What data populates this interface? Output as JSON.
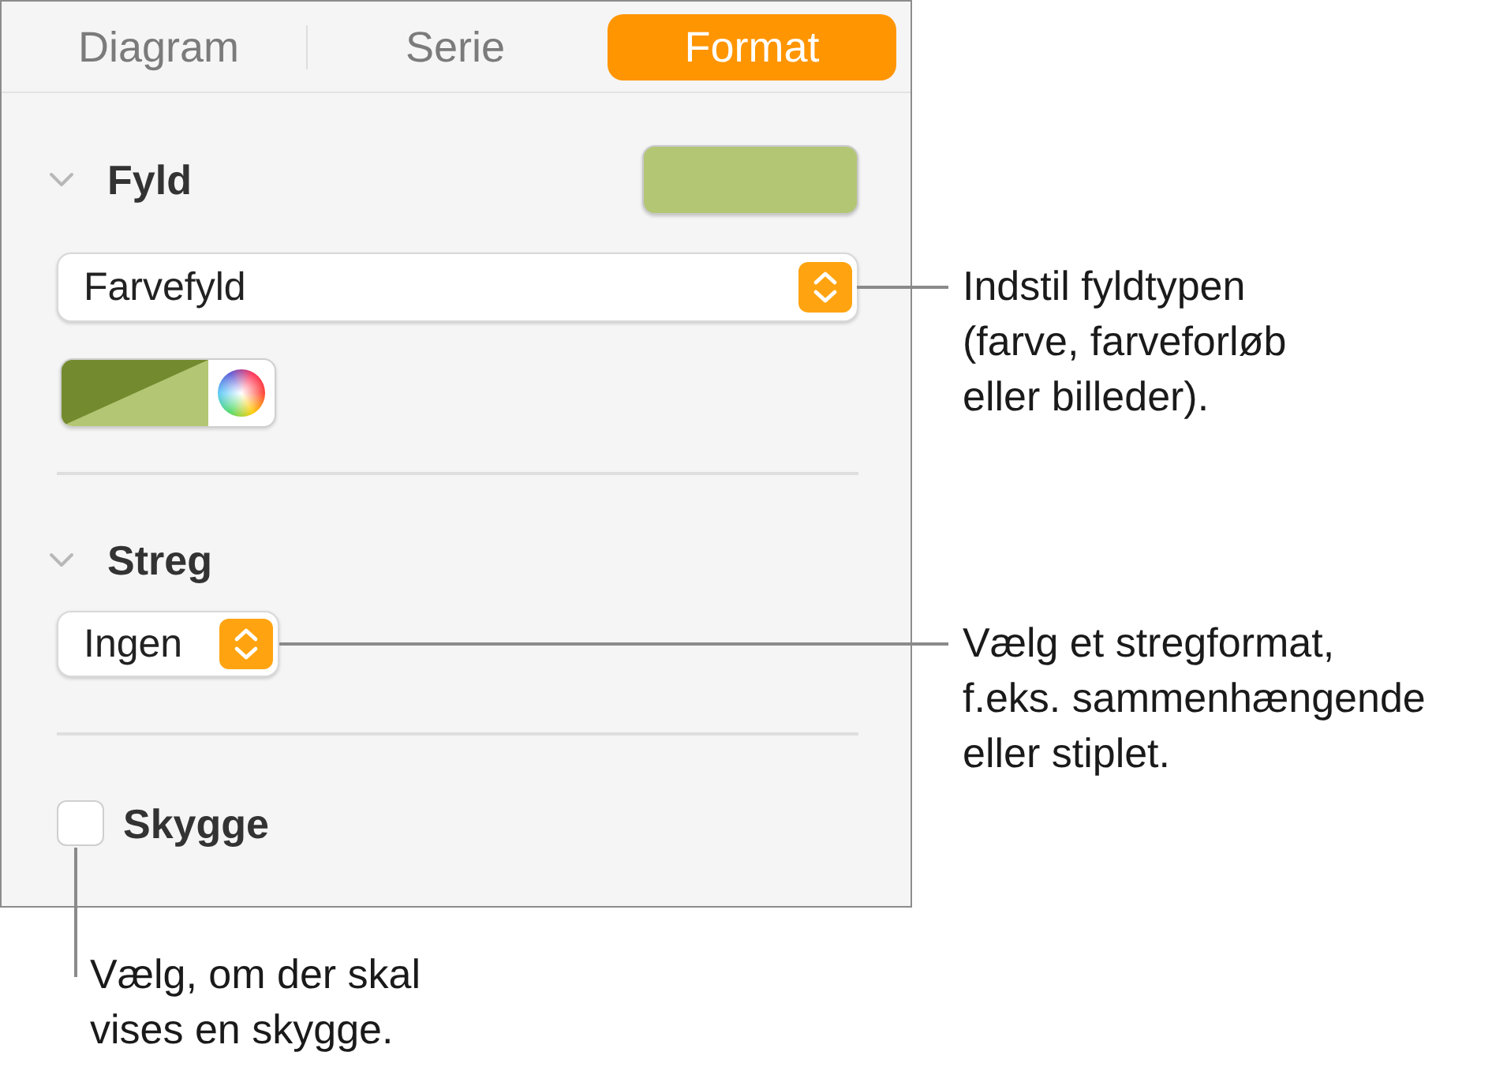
{
  "tabs": [
    {
      "label": "Diagram",
      "selected": false
    },
    {
      "label": "Serie",
      "selected": false
    },
    {
      "label": "Format",
      "selected": true
    }
  ],
  "fill": {
    "title": "Fyld",
    "expanded": true,
    "color": "#b3c674",
    "popup": "Farvefyld"
  },
  "stroke": {
    "title": "Streg",
    "expanded": true,
    "popup": "Ingen"
  },
  "shadow": {
    "label": "Skygge",
    "checked": false
  },
  "callouts": [
    {
      "lines": [
        "Indstil fyldtypen",
        "(farve, farveforløb",
        "eller billeder)."
      ]
    },
    {
      "lines": [
        "Vælg et stregformat,",
        "f.eks. sammenhængende",
        "eller stiplet."
      ]
    },
    {
      "lines": [
        "Vælg, om der skal",
        "vises en skygge."
      ]
    }
  ]
}
